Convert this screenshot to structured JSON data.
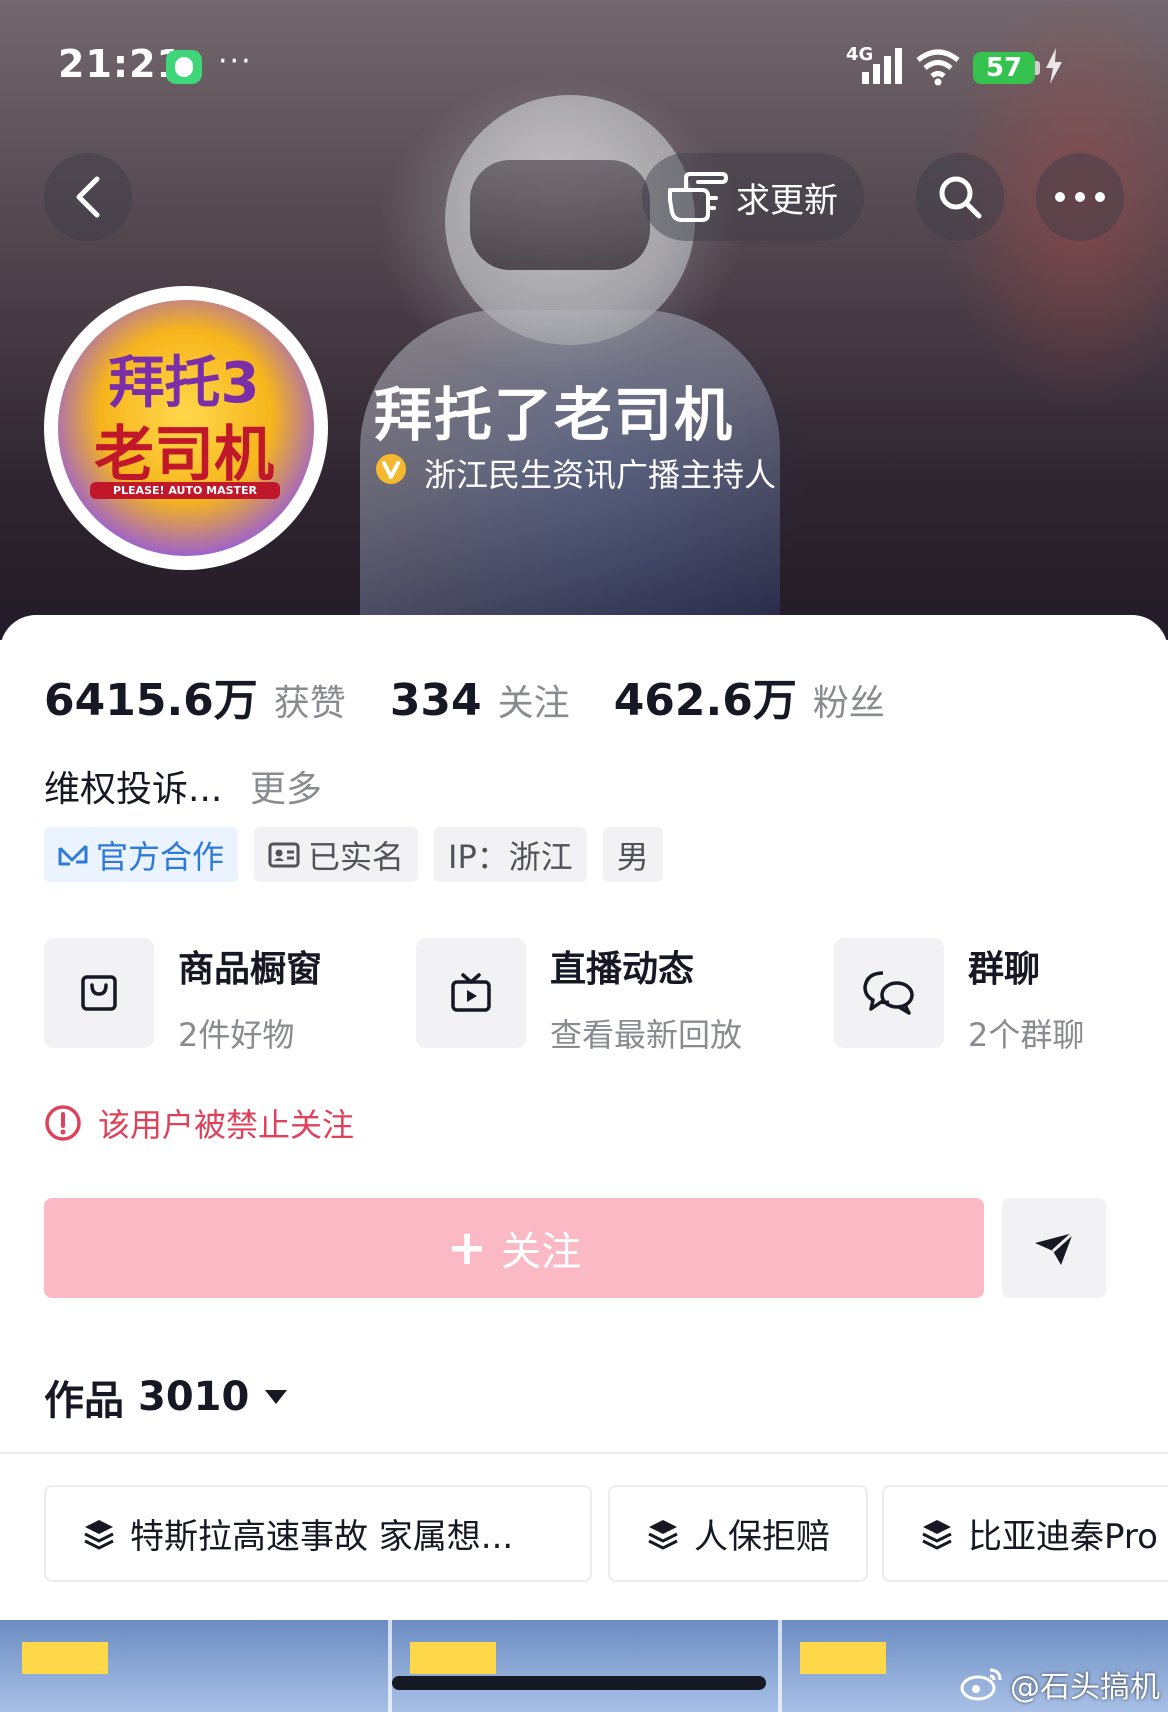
{
  "status_bar": {
    "time": "21:21",
    "dots": "···",
    "network": "4G",
    "battery": "57"
  },
  "top_nav": {
    "update_label": "求更新"
  },
  "profile": {
    "name": "拜托了老司机",
    "verification": "浙江民生资讯广播主持人",
    "avatar_text_line1": "拜托3",
    "avatar_text_line2": "老司机",
    "avatar_text_line3": "PLEASE! AUTO MASTER"
  },
  "stats": [
    {
      "value": "6415.6万",
      "label": "获赞"
    },
    {
      "value": "334",
      "label": "关注"
    },
    {
      "value": "462.6万",
      "label": "粉丝"
    }
  ],
  "bio": {
    "text": "维权投诉...",
    "more": "更多"
  },
  "tags": [
    "官方合作",
    "已实名",
    "IP：浙江",
    "男"
  ],
  "shortcuts": [
    {
      "title": "商品橱窗",
      "subtitle": "2件好物",
      "icon": "shopping-bag-icon"
    },
    {
      "title": "直播动态",
      "subtitle": "查看最新回放",
      "icon": "tv-icon"
    },
    {
      "title": "群聊",
      "subtitle": "2个群聊",
      "icon": "chat-bubbles-icon"
    }
  ],
  "warning": "该用户被禁止关注",
  "follow_button": {
    "plus": "+",
    "label": "关注"
  },
  "works": {
    "label": "作品",
    "count": "3010"
  },
  "collections": [
    "特斯拉高速事故 家属想...",
    "人保拒赔",
    "比亚迪秦Pro"
  ],
  "watermark": "@石头搞机",
  "colors": {
    "follow_button": "#fbb9c6",
    "warning": "#e0415a",
    "tag_blue": "#2e7ad8",
    "battery": "#35c24f"
  }
}
